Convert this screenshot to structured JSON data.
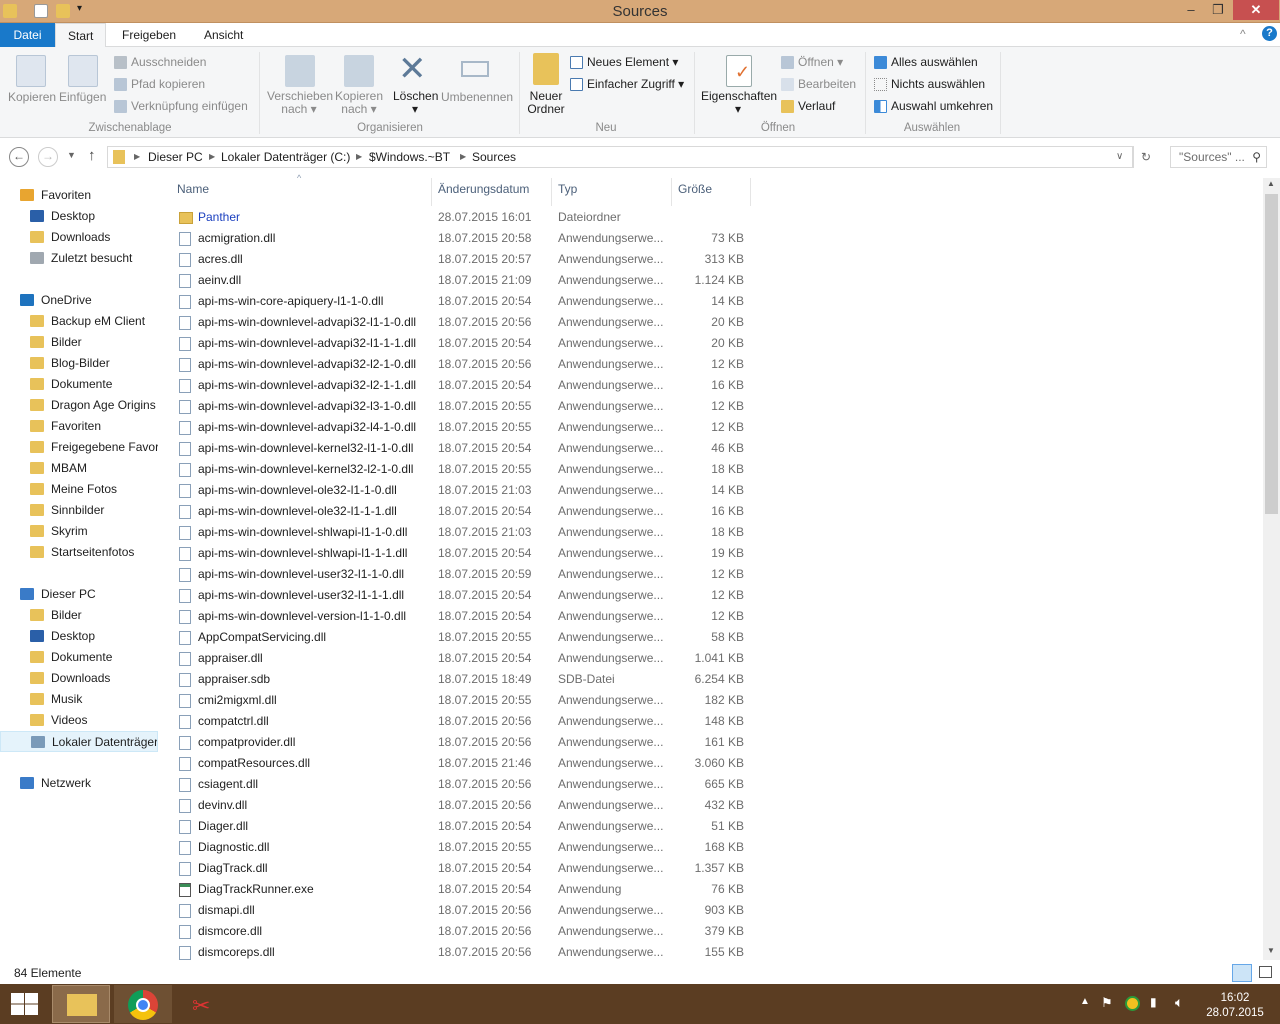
{
  "window": {
    "title": "Sources"
  },
  "tabs": [
    "Datei",
    "Start",
    "Freigeben",
    "Ansicht"
  ],
  "ribbon": {
    "clipboard": {
      "copy": "Kopieren",
      "paste": "Einfügen",
      "cut": "Ausschneiden",
      "copy_path": "Pfad kopieren",
      "paste_shortcut": "Verknüpfung einfügen",
      "group": "Zwischenablage"
    },
    "organize": {
      "move_to": "Verschieben",
      "move_to2": "nach",
      "copy_to": "Kopieren",
      "copy_to2": "nach",
      "delete": "Löschen",
      "rename": "Umbenennen",
      "group": "Organisieren"
    },
    "new": {
      "new_folder": "Neuer",
      "new_folder2": "Ordner",
      "new_item": "Neues Element",
      "easy_access": "Einfacher Zugriff",
      "group": "Neu"
    },
    "open": {
      "properties": "Eigenschaften",
      "open": "Öffnen",
      "edit": "Bearbeiten",
      "history": "Verlauf",
      "group": "Öffnen"
    },
    "select": {
      "select_all": "Alles auswählen",
      "select_none": "Nichts auswählen",
      "invert": "Auswahl umkehren",
      "group": "Auswählen"
    }
  },
  "address": {
    "crumbs": [
      "Dieser PC",
      "Lokaler Datenträger (C:)",
      "$Windows.~BT",
      "Sources"
    ],
    "search_placeholder": "\"Sources\" ..."
  },
  "sidebar": [
    {
      "label": "Favoriten",
      "type": "head",
      "icon": "star-icon",
      "color": "#e8a530"
    },
    {
      "label": "Desktop",
      "icon": "desktop-icon",
      "color": "#2a5fa8"
    },
    {
      "label": "Downloads",
      "icon": "downloads-folder-icon",
      "color": "#e8c25a"
    },
    {
      "label": "Zuletzt besucht",
      "icon": "recent-places-icon",
      "color": "#a0a8b0"
    },
    {
      "gap": true
    },
    {
      "label": "OneDrive",
      "type": "head",
      "icon": "cloud-icon",
      "color": "#1e73be"
    },
    {
      "label": "Backup eM Client",
      "icon": "folder-icon",
      "color": "#e8c25a"
    },
    {
      "label": "Bilder",
      "icon": "folder-icon",
      "color": "#e8c25a"
    },
    {
      "label": "Blog-Bilder",
      "icon": "folder-icon",
      "color": "#e8c25a"
    },
    {
      "label": "Dokumente",
      "icon": "folder-icon",
      "color": "#e8c25a"
    },
    {
      "label": "Dragon Age Origins",
      "icon": "folder-icon",
      "color": "#e8c25a"
    },
    {
      "label": "Favoriten",
      "icon": "folder-icon",
      "color": "#e8c25a"
    },
    {
      "label": "Freigegebene Favoriten",
      "icon": "folder-icon",
      "color": "#e8c25a"
    },
    {
      "label": "MBAM",
      "icon": "folder-icon",
      "color": "#e8c25a"
    },
    {
      "label": "Meine Fotos",
      "icon": "folder-icon",
      "color": "#e8c25a"
    },
    {
      "label": "Sinnbilder",
      "icon": "folder-icon",
      "color": "#e8c25a"
    },
    {
      "label": "Skyrim",
      "icon": "folder-icon",
      "color": "#e8c25a"
    },
    {
      "label": "Startseitenfotos",
      "icon": "folder-icon",
      "color": "#e8c25a"
    },
    {
      "gap": true
    },
    {
      "label": "Dieser PC",
      "type": "head",
      "icon": "computer-icon",
      "color": "#3a7bc8"
    },
    {
      "label": "Bilder",
      "icon": "pictures-folder-icon",
      "color": "#e8c25a"
    },
    {
      "label": "Desktop",
      "icon": "desktop-icon",
      "color": "#2a5fa8"
    },
    {
      "label": "Dokumente",
      "icon": "documents-folder-icon",
      "color": "#e8c25a"
    },
    {
      "label": "Downloads",
      "icon": "downloads-folder-icon",
      "color": "#e8c25a"
    },
    {
      "label": "Musik",
      "icon": "music-folder-icon",
      "color": "#e8c25a"
    },
    {
      "label": "Videos",
      "icon": "videos-folder-icon",
      "color": "#e8c25a"
    },
    {
      "label": "Lokaler Datenträger (C:)",
      "icon": "drive-icon",
      "color": "#7a9ab8",
      "selected": true
    },
    {
      "gap": true
    },
    {
      "label": "Netzwerk",
      "type": "head",
      "icon": "network-icon",
      "color": "#3a7bc8"
    }
  ],
  "columns": {
    "name": "Name",
    "date": "Änderungsdatum",
    "type": "Typ",
    "size": "Größe"
  },
  "files": [
    {
      "name": "Panther",
      "date": "28.07.2015 16:01",
      "type": "Dateiordner",
      "size": "",
      "kind": "folder"
    },
    {
      "name": "acmigration.dll",
      "date": "18.07.2015 20:58",
      "type": "Anwendungserwe...",
      "size": "73 KB"
    },
    {
      "name": "acres.dll",
      "date": "18.07.2015 20:57",
      "type": "Anwendungserwe...",
      "size": "313 KB"
    },
    {
      "name": "aeinv.dll",
      "date": "18.07.2015 21:09",
      "type": "Anwendungserwe...",
      "size": "1.124 KB"
    },
    {
      "name": "api-ms-win-core-apiquery-l1-1-0.dll",
      "date": "18.07.2015 20:54",
      "type": "Anwendungserwe...",
      "size": "14 KB"
    },
    {
      "name": "api-ms-win-downlevel-advapi32-l1-1-0.dll",
      "date": "18.07.2015 20:56",
      "type": "Anwendungserwe...",
      "size": "20 KB"
    },
    {
      "name": "api-ms-win-downlevel-advapi32-l1-1-1.dll",
      "date": "18.07.2015 20:54",
      "type": "Anwendungserwe...",
      "size": "20 KB"
    },
    {
      "name": "api-ms-win-downlevel-advapi32-l2-1-0.dll",
      "date": "18.07.2015 20:56",
      "type": "Anwendungserwe...",
      "size": "12 KB"
    },
    {
      "name": "api-ms-win-downlevel-advapi32-l2-1-1.dll",
      "date": "18.07.2015 20:54",
      "type": "Anwendungserwe...",
      "size": "16 KB"
    },
    {
      "name": "api-ms-win-downlevel-advapi32-l3-1-0.dll",
      "date": "18.07.2015 20:55",
      "type": "Anwendungserwe...",
      "size": "12 KB"
    },
    {
      "name": "api-ms-win-downlevel-advapi32-l4-1-0.dll",
      "date": "18.07.2015 20:55",
      "type": "Anwendungserwe...",
      "size": "12 KB"
    },
    {
      "name": "api-ms-win-downlevel-kernel32-l1-1-0.dll",
      "date": "18.07.2015 20:54",
      "type": "Anwendungserwe...",
      "size": "46 KB"
    },
    {
      "name": "api-ms-win-downlevel-kernel32-l2-1-0.dll",
      "date": "18.07.2015 20:55",
      "type": "Anwendungserwe...",
      "size": "18 KB"
    },
    {
      "name": "api-ms-win-downlevel-ole32-l1-1-0.dll",
      "date": "18.07.2015 21:03",
      "type": "Anwendungserwe...",
      "size": "14 KB"
    },
    {
      "name": "api-ms-win-downlevel-ole32-l1-1-1.dll",
      "date": "18.07.2015 20:54",
      "type": "Anwendungserwe...",
      "size": "16 KB"
    },
    {
      "name": "api-ms-win-downlevel-shlwapi-l1-1-0.dll",
      "date": "18.07.2015 21:03",
      "type": "Anwendungserwe...",
      "size": "18 KB"
    },
    {
      "name": "api-ms-win-downlevel-shlwapi-l1-1-1.dll",
      "date": "18.07.2015 20:54",
      "type": "Anwendungserwe...",
      "size": "19 KB"
    },
    {
      "name": "api-ms-win-downlevel-user32-l1-1-0.dll",
      "date": "18.07.2015 20:59",
      "type": "Anwendungserwe...",
      "size": "12 KB"
    },
    {
      "name": "api-ms-win-downlevel-user32-l1-1-1.dll",
      "date": "18.07.2015 20:54",
      "type": "Anwendungserwe...",
      "size": "12 KB"
    },
    {
      "name": "api-ms-win-downlevel-version-l1-1-0.dll",
      "date": "18.07.2015 20:54",
      "type": "Anwendungserwe...",
      "size": "12 KB"
    },
    {
      "name": "AppCompatServicing.dll",
      "date": "18.07.2015 20:55",
      "type": "Anwendungserwe...",
      "size": "58 KB"
    },
    {
      "name": "appraiser.dll",
      "date": "18.07.2015 20:54",
      "type": "Anwendungserwe...",
      "size": "1.041 KB"
    },
    {
      "name": "appraiser.sdb",
      "date": "18.07.2015 18:49",
      "type": "SDB-Datei",
      "size": "6.254 KB",
      "kind": "plain"
    },
    {
      "name": "cmi2migxml.dll",
      "date": "18.07.2015 20:55",
      "type": "Anwendungserwe...",
      "size": "182 KB"
    },
    {
      "name": "compatctrl.dll",
      "date": "18.07.2015 20:56",
      "type": "Anwendungserwe...",
      "size": "148 KB"
    },
    {
      "name": "compatprovider.dll",
      "date": "18.07.2015 20:56",
      "type": "Anwendungserwe...",
      "size": "161 KB"
    },
    {
      "name": "compatResources.dll",
      "date": "18.07.2015 21:46",
      "type": "Anwendungserwe...",
      "size": "3.060 KB"
    },
    {
      "name": "csiagent.dll",
      "date": "18.07.2015 20:56",
      "type": "Anwendungserwe...",
      "size": "665 KB"
    },
    {
      "name": "devinv.dll",
      "date": "18.07.2015 20:56",
      "type": "Anwendungserwe...",
      "size": "432 KB"
    },
    {
      "name": "Diager.dll",
      "date": "18.07.2015 20:54",
      "type": "Anwendungserwe...",
      "size": "51 KB"
    },
    {
      "name": "Diagnostic.dll",
      "date": "18.07.2015 20:55",
      "type": "Anwendungserwe...",
      "size": "168 KB"
    },
    {
      "name": "DiagTrack.dll",
      "date": "18.07.2015 20:54",
      "type": "Anwendungserwe...",
      "size": "1.357 KB"
    },
    {
      "name": "DiagTrackRunner.exe",
      "date": "18.07.2015 20:54",
      "type": "Anwendung",
      "size": "76 KB",
      "kind": "exe"
    },
    {
      "name": "dismapi.dll",
      "date": "18.07.2015 20:56",
      "type": "Anwendungserwe...",
      "size": "903 KB"
    },
    {
      "name": "dismcore.dll",
      "date": "18.07.2015 20:56",
      "type": "Anwendungserwe...",
      "size": "379 KB"
    },
    {
      "name": "dismcoreps.dll",
      "date": "18.07.2015 20:56",
      "type": "Anwendungserwe...",
      "size": "155 KB"
    }
  ],
  "status": {
    "count": "84 Elemente"
  },
  "taskbar": {
    "time": "16:02",
    "date": "28.07.2015"
  },
  "colors": {
    "accent": "#1979ca",
    "titlebar": "#d7a878",
    "taskbar": "#5b3d22",
    "link": "#1a3fbf"
  }
}
